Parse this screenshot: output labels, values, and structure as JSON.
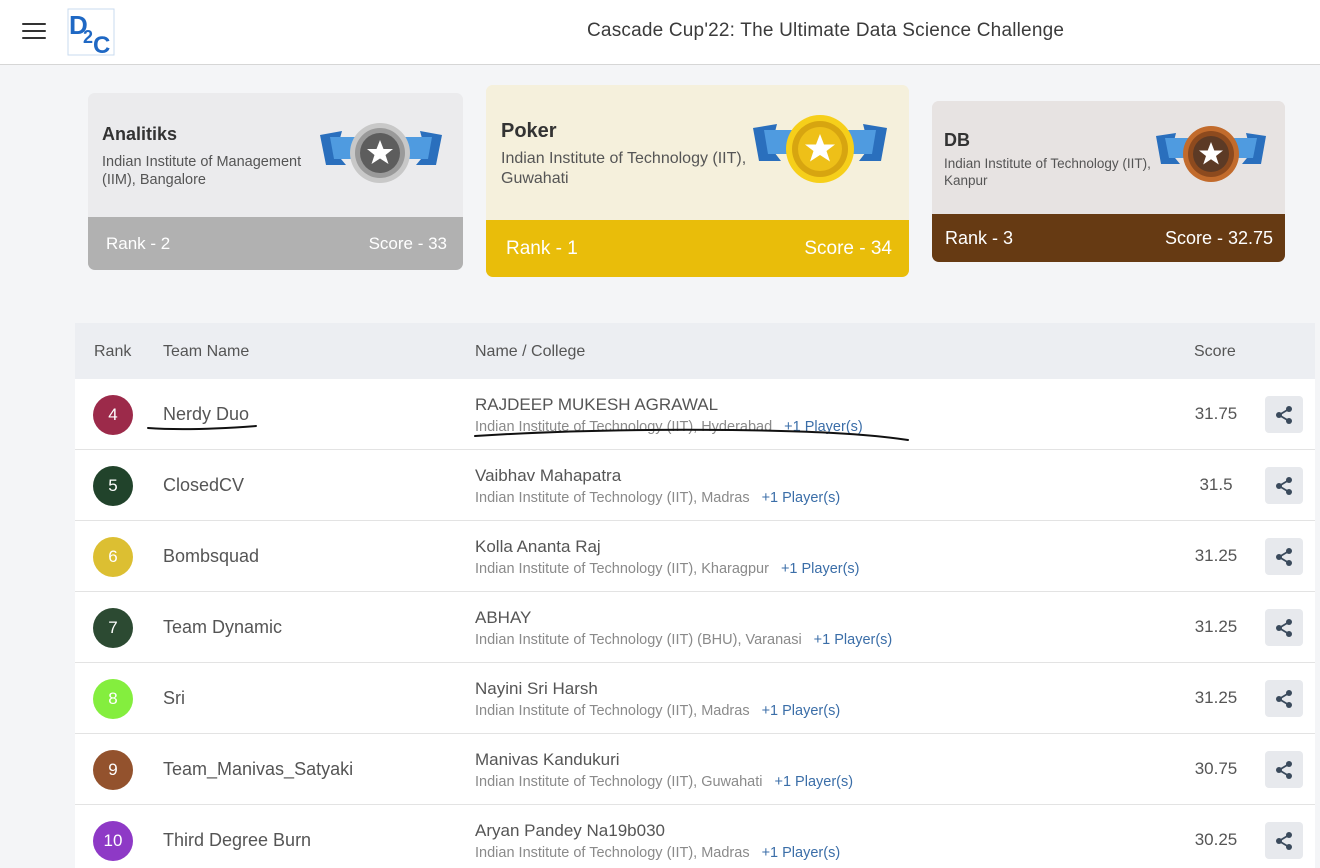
{
  "header": {
    "title": "Cascade Cup'22: The Ultimate Data Science Challenge",
    "menu_icon": "hamburger-menu-icon",
    "logo_text": "D2C"
  },
  "podium": [
    {
      "position": "second",
      "team": "Analitiks",
      "college": "Indian Institute of Management (IIM), Bangalore",
      "rank_label": "Rank - 2",
      "score_label": "Score - 33",
      "medal": "silver-medal-icon",
      "color": "#b1b1b1"
    },
    {
      "position": "first",
      "team": "Poker",
      "college": "Indian Institute of Technology (IIT), Guwahati",
      "rank_label": "Rank - 1",
      "score_label": "Score - 34",
      "medal": "gold-medal-icon",
      "color": "#e9bd0a"
    },
    {
      "position": "third",
      "team": "DB",
      "college": "Indian Institute of Technology (IIT), Kanpur",
      "rank_label": "Rank - 3",
      "score_label": "Score - 32.75",
      "medal": "bronze-medal-icon",
      "color": "#663a13"
    }
  ],
  "table": {
    "headers": {
      "rank": "Rank",
      "team": "Team Name",
      "name_college": "Name / College",
      "score": "Score"
    },
    "rows": [
      {
        "rank": "4",
        "team": "Nerdy Duo",
        "member": "RAJDEEP MUKESH AGRAWAL",
        "college": "Indian Institute of Technology (IIT), Hyderabad",
        "extra": "+1 Player(s)",
        "score": "31.75",
        "color": "#9c2a4a"
      },
      {
        "rank": "5",
        "team": "ClosedCV",
        "member": "Vaibhav Mahapatra",
        "college": "Indian Institute of Technology (IIT), Madras",
        "extra": "+1 Player(s)",
        "score": "31.5",
        "color": "#21432b"
      },
      {
        "rank": "6",
        "team": "Bombsquad",
        "member": "Kolla Ananta Raj",
        "college": "Indian Institute of Technology (IIT), Kharagpur",
        "extra": "+1 Player(s)",
        "score": "31.25",
        "color": "#dcbf32"
      },
      {
        "rank": "7",
        "team": "Team Dynamic",
        "member": "ABHAY",
        "college": "Indian Institute of Technology (IIT) (BHU), Varanasi",
        "extra": "+1 Player(s)",
        "score": "31.25",
        "color": "#2c4a32"
      },
      {
        "rank": "8",
        "team": "Sri",
        "member": "Nayini Sri Harsh",
        "college": "Indian Institute of Technology (IIT), Madras",
        "extra": "+1 Player(s)",
        "score": "31.25",
        "color": "#84ee3e"
      },
      {
        "rank": "9",
        "team": "Team_Manivas_Satyaki",
        "member": "Manivas Kandukuri",
        "college": "Indian Institute of Technology (IIT), Guwahati",
        "extra": "+1 Player(s)",
        "score": "30.75",
        "color": "#93522d"
      },
      {
        "rank": "10",
        "team": "Third Degree Burn",
        "member": "Aryan Pandey Na19b030",
        "college": "Indian Institute of Technology (IIT), Madras",
        "extra": "+1 Player(s)",
        "score": "30.25",
        "color": "#8e39c6"
      }
    ]
  }
}
